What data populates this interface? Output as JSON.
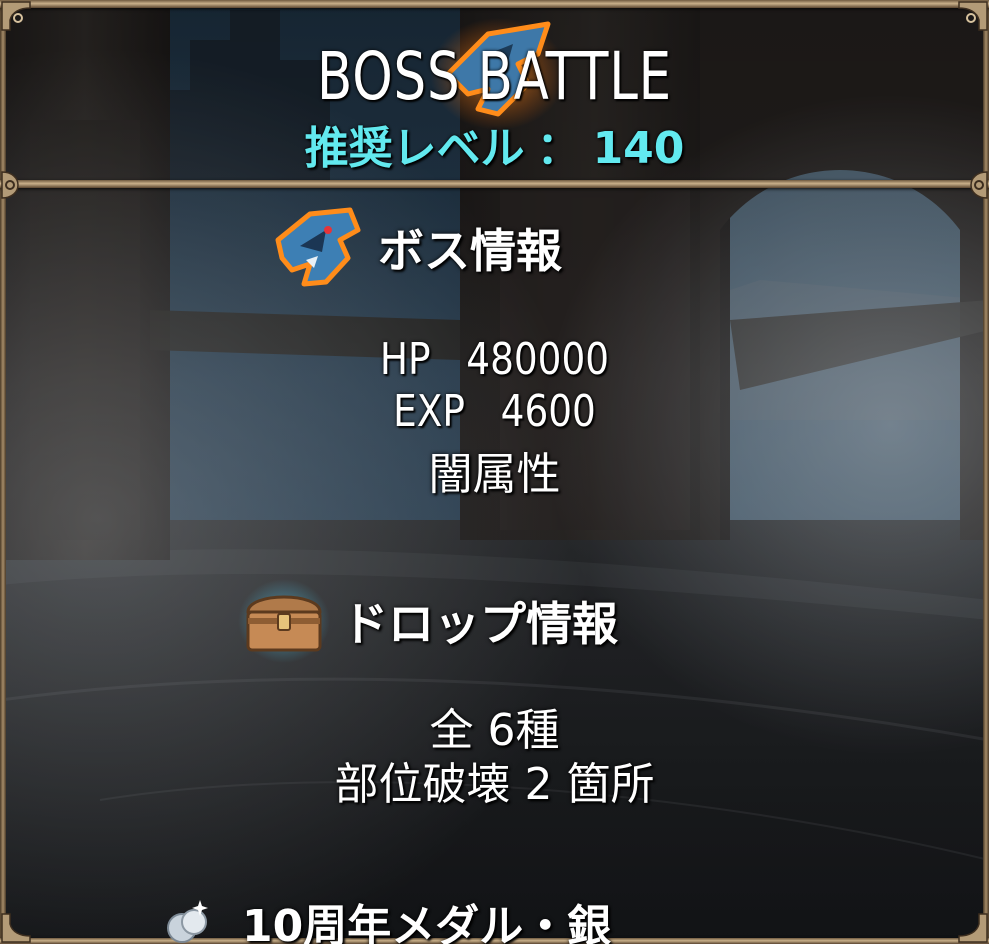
{
  "header": {
    "title": "BOSS BATTLE",
    "level_label": "推奨レベル",
    "level_separator": "：",
    "level_value": "140"
  },
  "boss_info": {
    "heading": "ボス情報",
    "icon": "dark-beast-icon",
    "hp_label": "HP",
    "hp_value": "480000",
    "exp_label": "EXP",
    "exp_value": "4600",
    "attribute": "闇属性"
  },
  "drop_info": {
    "heading": "ドロップ情報",
    "icon": "treasure-chest-icon",
    "total": "全 6種",
    "part_break": "部位破壊 2 箇所",
    "items": [
      {
        "name": "10周年メダル・銀",
        "icon": "silver-medal-icon"
      }
    ]
  },
  "colors": {
    "level_text": "#62e9ef",
    "frame": "#c9b08a",
    "text": "#ffffff"
  }
}
